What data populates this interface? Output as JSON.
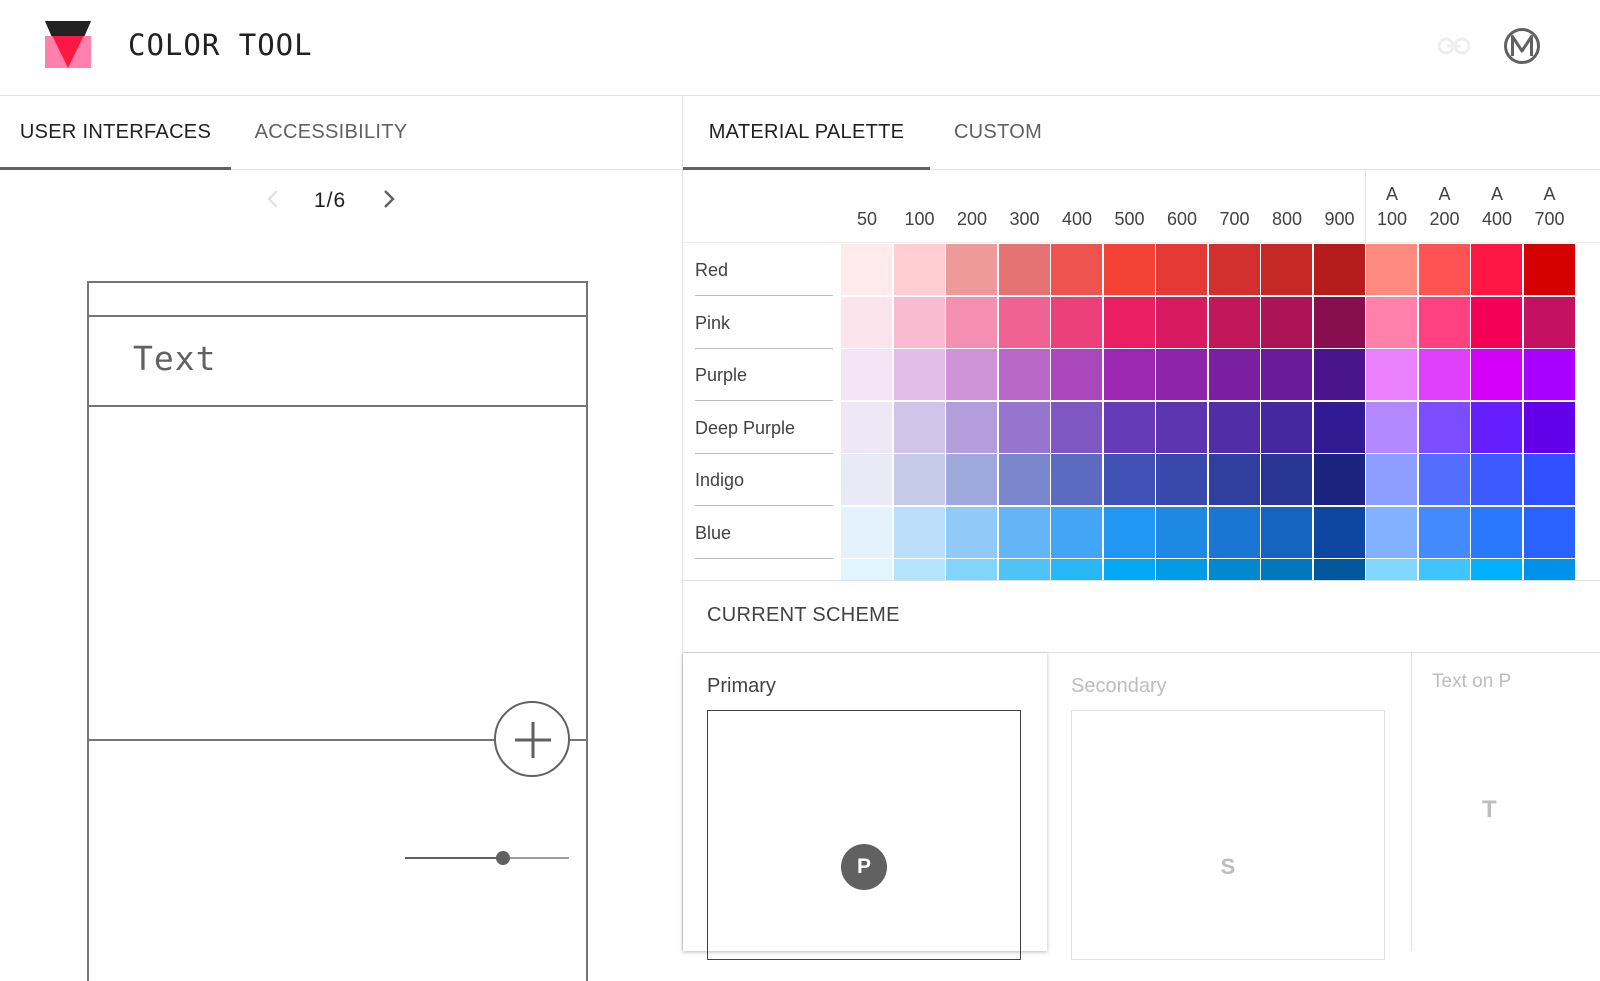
{
  "app": {
    "title": "COLOR TOOL",
    "logo_icon": "color-tool-logo",
    "link_icon": "link-icon",
    "brand_icon": "material-m-icon"
  },
  "left_panel": {
    "tabs": [
      {
        "label": "User Interfaces",
        "active": true
      },
      {
        "label": "Accessibility",
        "active": false
      }
    ],
    "pager": {
      "text": "1/6",
      "prev_icon": "chevron-left-icon",
      "next_icon": "chevron-right-icon"
    },
    "preview": {
      "toolbar_text": "Text",
      "fab_icon": "plus-icon",
      "slider_value": 0.6
    }
  },
  "right_panel": {
    "tabs": [
      {
        "label": "Material Palette",
        "active": true
      },
      {
        "label": "Custom",
        "active": false
      }
    ],
    "palette": {
      "shades": [
        {
          "top": "",
          "bottom": "50"
        },
        {
          "top": "",
          "bottom": "100"
        },
        {
          "top": "",
          "bottom": "200"
        },
        {
          "top": "",
          "bottom": "300"
        },
        {
          "top": "",
          "bottom": "400"
        },
        {
          "top": "",
          "bottom": "500"
        },
        {
          "top": "",
          "bottom": "600"
        },
        {
          "top": "",
          "bottom": "700"
        },
        {
          "top": "",
          "bottom": "800"
        },
        {
          "top": "",
          "bottom": "900"
        },
        {
          "top": "A",
          "bottom": "100"
        },
        {
          "top": "A",
          "bottom": "200"
        },
        {
          "top": "A",
          "bottom": "400"
        },
        {
          "top": "A",
          "bottom": "700"
        }
      ],
      "rows": [
        {
          "name": "Red",
          "colors": [
            "#FFEBEE",
            "#FFCDD2",
            "#EF9A9A",
            "#E57373",
            "#EF5350",
            "#F44336",
            "#E53935",
            "#D32F2F",
            "#C62828",
            "#B71C1C",
            "#FF8A80",
            "#FF5252",
            "#FF1744",
            "#D50000"
          ]
        },
        {
          "name": "Pink",
          "colors": [
            "#FCE4EC",
            "#F8BBD0",
            "#F48FB1",
            "#F06292",
            "#EC407A",
            "#E91E63",
            "#D81B60",
            "#C2185B",
            "#AD1457",
            "#880E4F",
            "#FF80AB",
            "#FF4081",
            "#F50057",
            "#C51162"
          ]
        },
        {
          "name": "Purple",
          "colors": [
            "#F3E5F5",
            "#E1BEE7",
            "#CE93D8",
            "#BA68C8",
            "#AB47BC",
            "#9C27B0",
            "#8E24AA",
            "#7B1FA2",
            "#6A1B9A",
            "#4A148C",
            "#EA80FC",
            "#E040FB",
            "#D500F9",
            "#AA00FF"
          ]
        },
        {
          "name": "Deep Purple",
          "colors": [
            "#EDE7F6",
            "#D1C4E9",
            "#B39DDB",
            "#9575CD",
            "#7E57C2",
            "#673AB7",
            "#5E35B1",
            "#512DA8",
            "#4527A0",
            "#311B92",
            "#B388FF",
            "#7C4DFF",
            "#651FFF",
            "#6200EA"
          ]
        },
        {
          "name": "Indigo",
          "colors": [
            "#E8EAF6",
            "#C5CAE9",
            "#9FA8DA",
            "#7986CB",
            "#5C6BC0",
            "#3F51B5",
            "#3949AB",
            "#303F9F",
            "#283593",
            "#1A237E",
            "#8C9EFF",
            "#536DFE",
            "#3D5AFE",
            "#304FFE"
          ]
        },
        {
          "name": "Blue",
          "colors": [
            "#E3F2FD",
            "#BBDEFB",
            "#90CAF9",
            "#64B5F6",
            "#42A5F5",
            "#2196F3",
            "#1E88E5",
            "#1976D2",
            "#1565C0",
            "#0D47A1",
            "#82B1FF",
            "#448AFF",
            "#2979FF",
            "#2962FF"
          ]
        },
        {
          "name": "",
          "colors": [
            "#E1F5FE",
            "#B3E5FC",
            "#81D4FA",
            "#4FC3F7",
            "#29B6F6",
            "#03A9F4",
            "#039BE5",
            "#0288D1",
            "#0277BD",
            "#01579B",
            "#80D8FF",
            "#40C4FF",
            "#00B0FF",
            "#0091EA"
          ]
        }
      ]
    },
    "scheme": {
      "title": "Current Scheme",
      "primary_label": "Primary",
      "primary_badge": "P",
      "secondary_label": "Secondary",
      "secondary_badge": "S",
      "text_on_label": "Text on P",
      "text_on_badge": "T"
    }
  }
}
